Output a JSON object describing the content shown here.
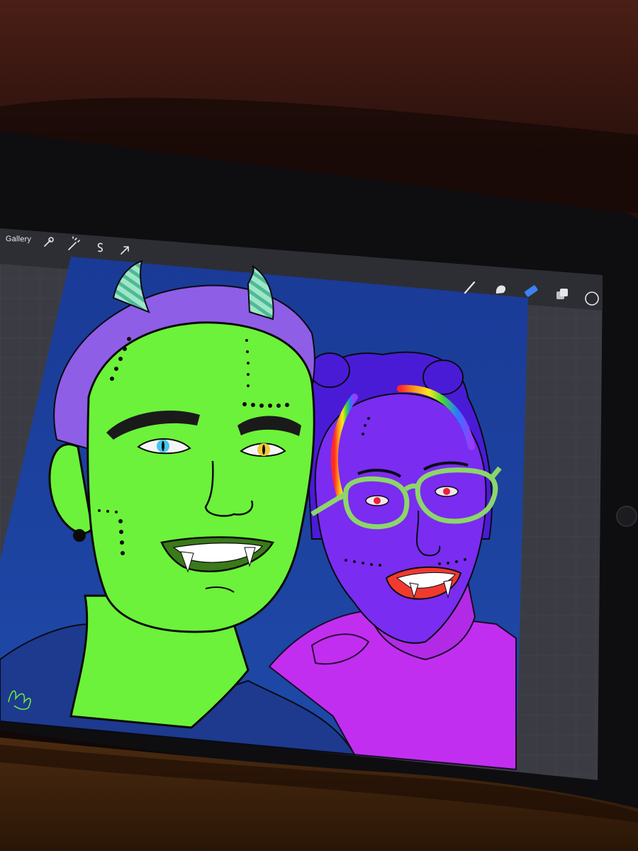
{
  "app": {
    "toolbar": {
      "gallery_label": "Gallery",
      "left_tools": [
        {
          "name": "actions",
          "icon": "wrench-icon"
        },
        {
          "name": "adjustments",
          "icon": "magic-wand-icon"
        },
        {
          "name": "selection",
          "icon": "selection-s-icon"
        },
        {
          "name": "transform",
          "icon": "arrow-cursor-icon"
        }
      ],
      "right_tools": [
        {
          "name": "brush",
          "icon": "brush-icon"
        },
        {
          "name": "smudge",
          "icon": "smudge-finger-icon"
        },
        {
          "name": "eraser",
          "icon": "eraser-icon",
          "active": true
        },
        {
          "name": "layers",
          "icon": "layers-icon"
        },
        {
          "name": "color",
          "icon": "color-circle-icon"
        }
      ]
    },
    "colors": {
      "accent": "#3b82f6",
      "canvas_bg": "#1b3f96",
      "workspace": "#3c3d44",
      "green_skin": "#6cf23a",
      "purple_skin": "#7a2cf0",
      "hair_purple": "#8f5ee6",
      "magenta": "#c22ef0",
      "glasses": "#8cd669"
    }
  }
}
